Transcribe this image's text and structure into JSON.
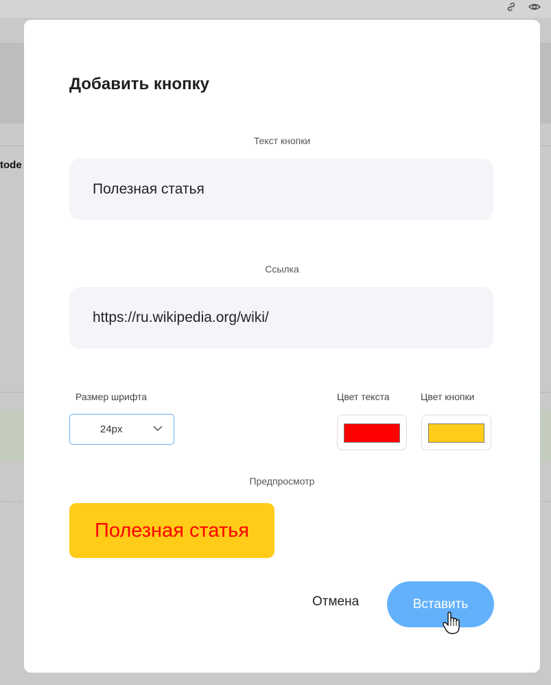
{
  "background": {
    "fragment_text": "tode",
    "link_icon": "link-icon",
    "eye_icon": "eye-icon"
  },
  "dialog": {
    "title": "Добавить кнопку",
    "button_text_field": {
      "label": "Текст кнопки",
      "value": "Полезная статья"
    },
    "link_field": {
      "label": "Ссылка",
      "value": "https://ru.wikipedia.org/wiki/"
    },
    "font_size": {
      "label": "Размер шрифта",
      "selected": "24px"
    },
    "text_color": {
      "label": "Цвет текста",
      "value": "#ff0000"
    },
    "button_color": {
      "label": "Цвет кнопки",
      "value": "#ffcc1a"
    },
    "preview": {
      "label": "Предпросмотр",
      "text": "Полезная статья"
    },
    "actions": {
      "cancel_label": "Отмена",
      "submit_label": "Вставить"
    }
  },
  "colors": {
    "overlay": "#c9c9c9",
    "field_bg": "#f3f5f9",
    "submit_bg": "#63b1fb",
    "select_border": "#6aaef2"
  }
}
